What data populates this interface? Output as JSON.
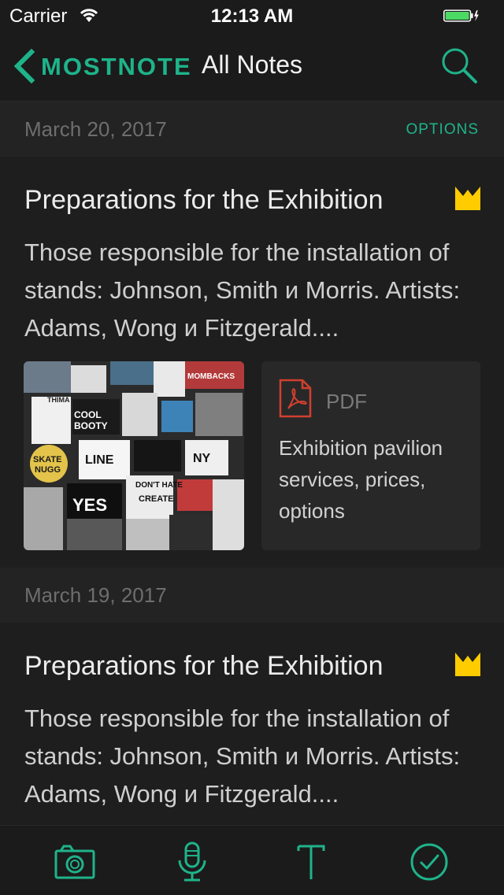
{
  "status": {
    "carrier": "Carrier",
    "time": "12:13 AM"
  },
  "nav": {
    "brand": "MOSTNOTE",
    "title": "All Notes"
  },
  "colors": {
    "accent": "#1fb38a",
    "flag": "#ffcc00",
    "pdf": "#d0402f"
  },
  "groups": [
    {
      "date": "March 20, 2017",
      "options": "OPTIONS",
      "note": {
        "title": "Preparations for the Exhibition",
        "body": "Those responsible for the installation of stands: Johnson, Smith и Morris. Artists: Adams, Wong и Fitzgerald....",
        "attachment": {
          "type": "PDF",
          "description": "Exhibition pavilion services, prices, options"
        }
      }
    },
    {
      "date": "March 19, 2017",
      "note": {
        "title": "Preparations for the Exhibition",
        "body": "Those responsible for the installation of stands: Johnson, Smith и Morris. Artists: Adams, Wong и Fitzgerald...."
      }
    }
  ],
  "photo_stickers": [
    "SKATE NUGG",
    "COOL BOOTY",
    "DON'T HATE",
    "CREATE",
    "NY",
    "MOMBACKS",
    "THIMA",
    "LINE",
    "YES"
  ],
  "icons": {
    "back": "chevron-left-icon",
    "search": "search-icon",
    "flag": "bookmark-flag-icon",
    "pdf": "pdf-file-icon",
    "camera": "camera-icon",
    "mic": "microphone-icon",
    "text": "text-icon",
    "check": "checkmark-circle-icon"
  }
}
